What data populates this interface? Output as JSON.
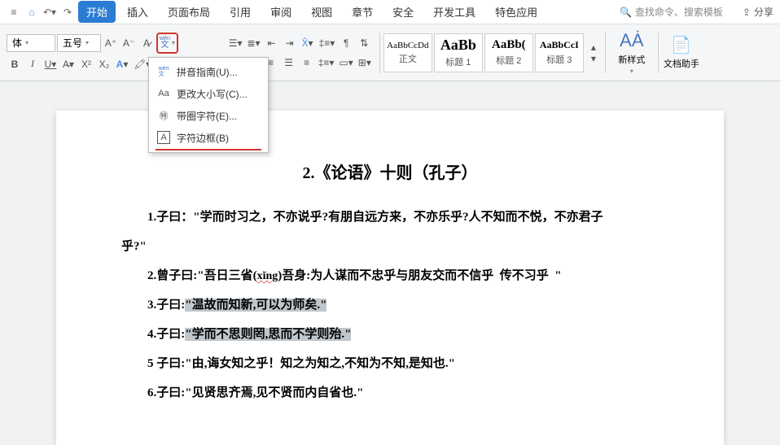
{
  "menubar": {
    "tabs": [
      "开始",
      "插入",
      "页面布局",
      "引用",
      "审阅",
      "视图",
      "章节",
      "安全",
      "开发工具",
      "特色应用"
    ],
    "search": "查找命令、搜索模板",
    "share": "分享"
  },
  "toolbar": {
    "font_name": "体",
    "font_size": "五号",
    "dropdown": {
      "items": [
        {
          "icon": "wen",
          "label": "拼音指南(U)..."
        },
        {
          "icon": "case",
          "label": "更改大小写(C)..."
        },
        {
          "icon": "circle",
          "label": "带圈字符(E)..."
        },
        {
          "icon": "box",
          "label": "字符边框(B)"
        }
      ]
    },
    "styles": [
      {
        "preview": "AaBbCcDd",
        "label": "正文",
        "size": "11px"
      },
      {
        "preview": "AaBb",
        "label": "标题 1",
        "size": "18px",
        "bold": true
      },
      {
        "preview": "AaBb(",
        "label": "标题 2",
        "size": "15px",
        "bold": true
      },
      {
        "preview": "AaBbCcI",
        "label": "标题 3",
        "size": "12px",
        "bold": true
      }
    ],
    "new_style": "新样式",
    "doc_assist": "文档助手"
  },
  "document": {
    "title": "2.《论语》十则（孔子）",
    "paras": [
      "1.子曰：\"学而时习之，不亦说乎?有朋自远方来，不亦乐乎?人不知而不悦，不亦君子",
      "乎?\"",
      "2.曾子曰:\"吾日三省(xǐng)吾身:为人谋而不忠乎与朋友交而不信乎  传不习乎  \"",
      "3.子曰:\"温故而知新,可以为师矣.\"",
      "4.子曰:\"学而不思则罔,思而不学则殆.\"",
      "5 子曰:\"由,诲女知之乎！知之为知之,不知为不知,是知也.\"",
      "6.子曰:\"见贤思齐焉,见不贤而内自省也.\""
    ]
  }
}
